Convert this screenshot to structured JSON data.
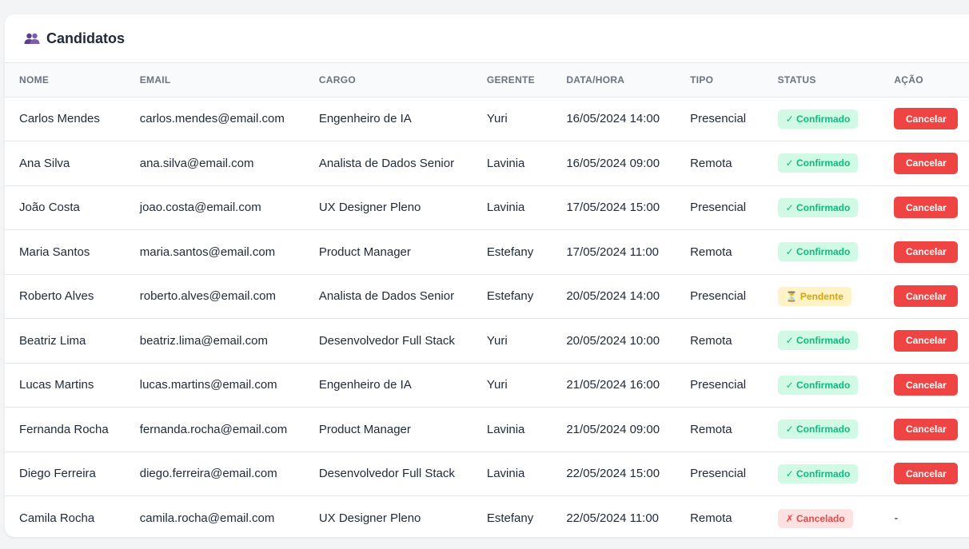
{
  "card": {
    "title": "Candidatos",
    "icon": "people-icon"
  },
  "columns": [
    "NOME",
    "EMAIL",
    "CARGO",
    "GERENTE",
    "DATA/HORA",
    "TIPO",
    "STATUS",
    "AÇÃO"
  ],
  "status_labels": {
    "confirmed": "✓ Confirmado",
    "pending": "⏳ Pendente",
    "canceled": "✗ Cancelado"
  },
  "action_label": "Cancelar",
  "no_action_label": "-",
  "colors": {
    "accent": "#ef4444",
    "confirmed_bg": "#d1fae5",
    "confirmed_text": "#10b981",
    "pending_bg": "#fef3c7",
    "pending_text": "#d9a406",
    "canceled_bg": "#fee2e2",
    "canceled_text": "#ef4444"
  },
  "rows": [
    {
      "nome": "Carlos Mendes",
      "email": "carlos.mendes@email.com",
      "cargo": "Engenheiro de IA",
      "gerente": "Yuri",
      "data_hora": "16/05/2024 14:00",
      "tipo": "Presencial",
      "status": "confirmed"
    },
    {
      "nome": "Ana Silva",
      "email": "ana.silva@email.com",
      "cargo": "Analista de Dados Senior",
      "gerente": "Lavinia",
      "data_hora": "16/05/2024 09:00",
      "tipo": "Remota",
      "status": "confirmed"
    },
    {
      "nome": "João Costa",
      "email": "joao.costa@email.com",
      "cargo": "UX Designer Pleno",
      "gerente": "Lavinia",
      "data_hora": "17/05/2024 15:00",
      "tipo": "Presencial",
      "status": "confirmed"
    },
    {
      "nome": "Maria Santos",
      "email": "maria.santos@email.com",
      "cargo": "Product Manager",
      "gerente": "Estefany",
      "data_hora": "17/05/2024 11:00",
      "tipo": "Remota",
      "status": "confirmed"
    },
    {
      "nome": "Roberto Alves",
      "email": "roberto.alves@email.com",
      "cargo": "Analista de Dados Senior",
      "gerente": "Estefany",
      "data_hora": "20/05/2024 14:00",
      "tipo": "Presencial",
      "status": "pending"
    },
    {
      "nome": "Beatriz Lima",
      "email": "beatriz.lima@email.com",
      "cargo": "Desenvolvedor Full Stack",
      "gerente": "Yuri",
      "data_hora": "20/05/2024 10:00",
      "tipo": "Remota",
      "status": "confirmed"
    },
    {
      "nome": "Lucas Martins",
      "email": "lucas.martins@email.com",
      "cargo": "Engenheiro de IA",
      "gerente": "Yuri",
      "data_hora": "21/05/2024 16:00",
      "tipo": "Presencial",
      "status": "confirmed"
    },
    {
      "nome": "Fernanda Rocha",
      "email": "fernanda.rocha@email.com",
      "cargo": "Product Manager",
      "gerente": "Lavinia",
      "data_hora": "21/05/2024 09:00",
      "tipo": "Remota",
      "status": "confirmed"
    },
    {
      "nome": "Diego Ferreira",
      "email": "diego.ferreira@email.com",
      "cargo": "Desenvolvedor Full Stack",
      "gerente": "Lavinia",
      "data_hora": "22/05/2024 15:00",
      "tipo": "Presencial",
      "status": "confirmed"
    },
    {
      "nome": "Camila Rocha",
      "email": "camila.rocha@email.com",
      "cargo": "UX Designer Pleno",
      "gerente": "Estefany",
      "data_hora": "22/05/2024 11:00",
      "tipo": "Remota",
      "status": "canceled"
    }
  ]
}
